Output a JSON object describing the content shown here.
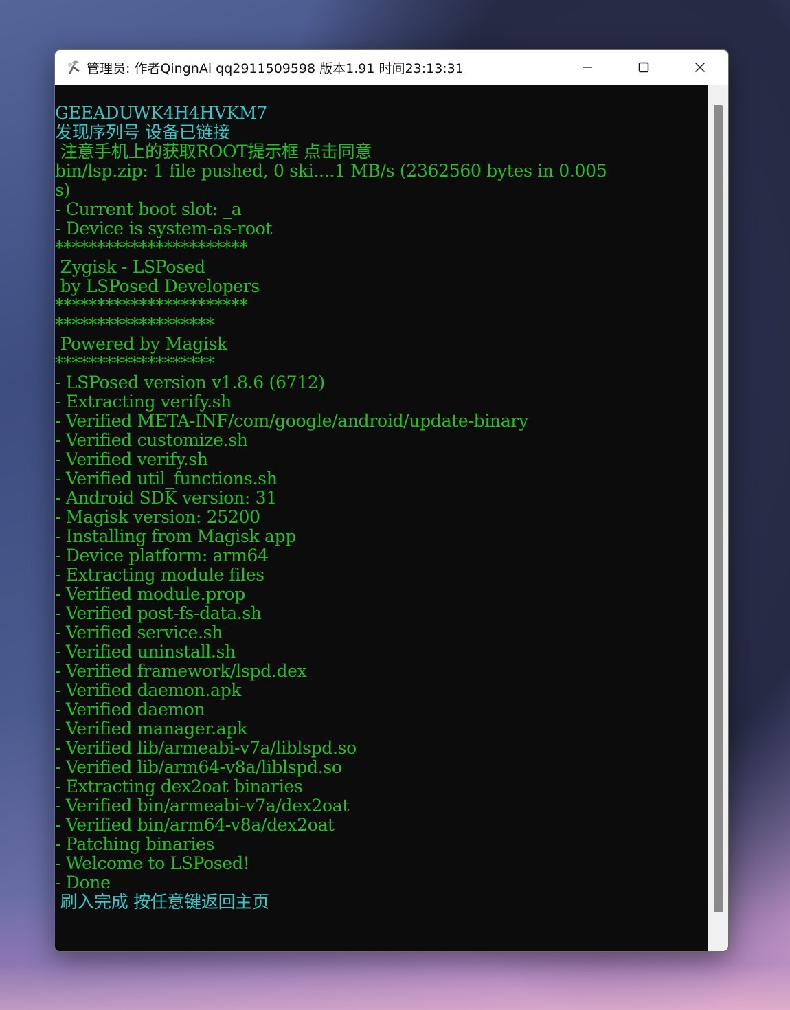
{
  "window": {
    "title": "管理员:  作者QingnAi qq2911509598  版本1.91 时间23:13:31",
    "icons": [
      "app-icon",
      "minimize-icon",
      "maximize-icon",
      "close-icon"
    ]
  },
  "colors": {
    "console_bg": "#0c0c0c",
    "text_green": "#25c025",
    "text_cyan": "#38c8c8",
    "titlebar_bg": "#ffffff"
  },
  "console": {
    "lines": [
      {
        "text": "GEEADUWK4H4HVKM7",
        "color": "cyan"
      },
      {
        "text": "发现序列号 设备已链接",
        "color": "cyan"
      },
      {
        "text": " 注意手机上的获取ROOT提示框 点击同意",
        "color": "green"
      },
      {
        "text": "bin/lsp.zip: 1 file pushed, 0 ski....1 MB/s (2362560 bytes in 0.005",
        "color": "green"
      },
      {
        "text": "s)",
        "color": "green"
      },
      {
        "text": "- Current boot slot: _a",
        "color": "green"
      },
      {
        "text": "- Device is system-as-root",
        "color": "green"
      },
      {
        "text": "***********************",
        "color": "green"
      },
      {
        "text": " Zygisk - LSPosed",
        "color": "green"
      },
      {
        "text": " by LSPosed Developers",
        "color": "green"
      },
      {
        "text": "***********************",
        "color": "green"
      },
      {
        "text": "*******************",
        "color": "green"
      },
      {
        "text": " Powered by Magisk",
        "color": "green"
      },
      {
        "text": "*******************",
        "color": "green"
      },
      {
        "text": "- LSPosed version v1.8.6 (6712)",
        "color": "green"
      },
      {
        "text": "- Extracting verify.sh",
        "color": "green"
      },
      {
        "text": "- Verified META-INF/com/google/android/update-binary",
        "color": "green"
      },
      {
        "text": "- Verified customize.sh",
        "color": "green"
      },
      {
        "text": "- Verified verify.sh",
        "color": "green"
      },
      {
        "text": "- Verified util_functions.sh",
        "color": "green"
      },
      {
        "text": "- Android SDK version: 31",
        "color": "green"
      },
      {
        "text": "- Magisk version: 25200",
        "color": "green"
      },
      {
        "text": "- Installing from Magisk app",
        "color": "green"
      },
      {
        "text": "- Device platform: arm64",
        "color": "green"
      },
      {
        "text": "- Extracting module files",
        "color": "green"
      },
      {
        "text": "- Verified module.prop",
        "color": "green"
      },
      {
        "text": "- Verified post-fs-data.sh",
        "color": "green"
      },
      {
        "text": "- Verified service.sh",
        "color": "green"
      },
      {
        "text": "- Verified uninstall.sh",
        "color": "green"
      },
      {
        "text": "- Verified framework/lspd.dex",
        "color": "green"
      },
      {
        "text": "- Verified daemon.apk",
        "color": "green"
      },
      {
        "text": "- Verified daemon",
        "color": "green"
      },
      {
        "text": "- Verified manager.apk",
        "color": "green"
      },
      {
        "text": "- Verified lib/armeabi-v7a/liblspd.so",
        "color": "green"
      },
      {
        "text": "- Verified lib/arm64-v8a/liblspd.so",
        "color": "green"
      },
      {
        "text": "- Extracting dex2oat binaries",
        "color": "green"
      },
      {
        "text": "- Verified bin/armeabi-v7a/dex2oat",
        "color": "green"
      },
      {
        "text": "- Verified bin/arm64-v8a/dex2oat",
        "color": "green"
      },
      {
        "text": "- Patching binaries",
        "color": "green"
      },
      {
        "text": "- Welcome to LSPosed!",
        "color": "green"
      },
      {
        "text": "- Done",
        "color": "green"
      },
      {
        "text": " 刷入完成 按任意键返回主页",
        "color": "cyan"
      }
    ]
  }
}
